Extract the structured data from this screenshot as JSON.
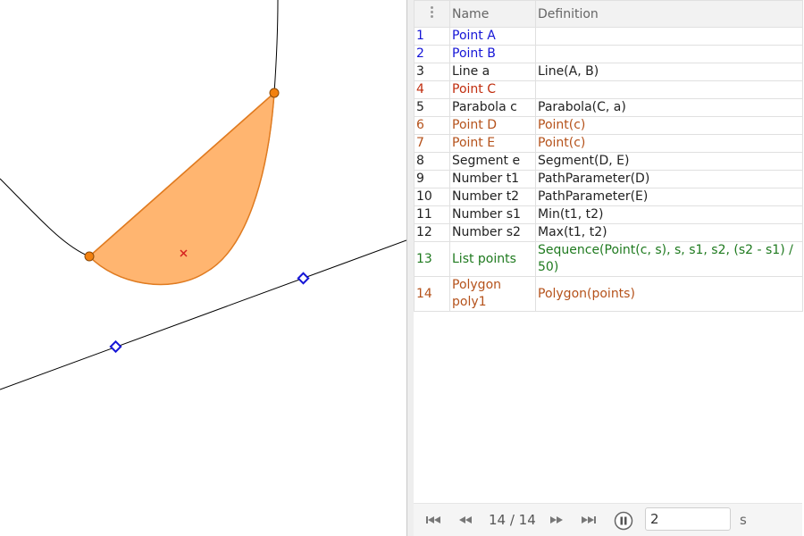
{
  "graphics": {
    "colors": {
      "polygon_fill": "#FFB570",
      "polygon_stroke": "#E07B20",
      "line": "#000000",
      "point_orange": "#F2810F",
      "point_blue": "#1515D6",
      "centroid": "#D52020"
    }
  },
  "protocol": {
    "headers": {
      "name": "Name",
      "definition": "Definition"
    },
    "rows": [
      {
        "num": "1",
        "name": "Point A",
        "definition": "",
        "color": "blue"
      },
      {
        "num": "2",
        "name": "Point B",
        "definition": "",
        "color": "blue"
      },
      {
        "num": "3",
        "name": "Line a",
        "definition": "Line(A, B)",
        "color": "black"
      },
      {
        "num": "4",
        "name": "Point C",
        "definition": "",
        "color": "red"
      },
      {
        "num": "5",
        "name": "Parabola c",
        "definition": "Parabola(C, a)",
        "color": "black"
      },
      {
        "num": "6",
        "name": "Point D",
        "definition": "Point(c)",
        "color": "orange"
      },
      {
        "num": "7",
        "name": "Point E",
        "definition": "Point(c)",
        "color": "orange"
      },
      {
        "num": "8",
        "name": "Segment e",
        "definition": "Segment(D, E)",
        "color": "black"
      },
      {
        "num": "9",
        "name": "Number t1",
        "definition": "PathParameter(D)",
        "color": "black"
      },
      {
        "num": "10",
        "name": "Number t2",
        "definition": "PathParameter(E)",
        "color": "black"
      },
      {
        "num": "11",
        "name": "Number s1",
        "definition": "Min(t1, t2)",
        "color": "black"
      },
      {
        "num": "12",
        "name": "Number s2",
        "definition": "Max(t1, t2)",
        "color": "black"
      },
      {
        "num": "13",
        "name": "List points",
        "definition": "Sequence(Point(c, s), s, s1, s2, (s2 - s1) / 50)",
        "color": "green"
      },
      {
        "num": "14",
        "name": "Polygon poly1",
        "definition": "Polygon(points)",
        "color": "orange"
      }
    ]
  },
  "navigation": {
    "step_text": "14 / 14",
    "speed_value": "2",
    "speed_unit": "s",
    "icons": [
      "first-step-icon",
      "previous-step-icon",
      "next-step-icon",
      "last-step-icon",
      "pause-icon"
    ]
  }
}
